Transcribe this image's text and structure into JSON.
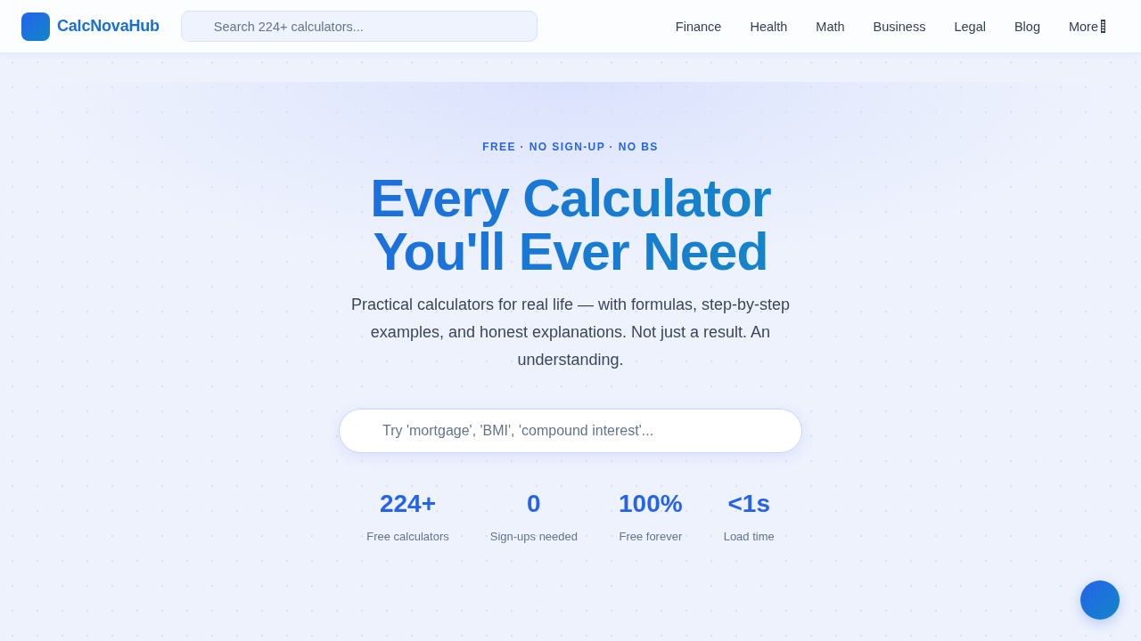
{
  "header": {
    "brand": "CalcNovaHub",
    "search": {
      "placeholder": "Search 224+ calculators..."
    },
    "nav": [
      {
        "label": "Finance",
        "kind": "link"
      },
      {
        "label": "Health",
        "kind": "link"
      },
      {
        "label": "Math",
        "kind": "link"
      },
      {
        "label": "Business",
        "kind": "link"
      },
      {
        "label": "Legal",
        "kind": "link"
      },
      {
        "label": "Blog",
        "kind": "link"
      },
      {
        "label": "More",
        "kind": "dropdown"
      }
    ]
  },
  "hero": {
    "eyebrow": "FREE · NO SIGN-UP · NO BS",
    "title": "Every Calculator You'll Ever Need",
    "subtitle": "Practical calculators for real life — with formulas, step-by-step examples, and honest explanations. Not just a result. An understanding.",
    "search": {
      "placeholder": "Try 'mortgage', 'BMI', 'compound interest'..."
    },
    "stats": [
      {
        "value": "224+",
        "label": "Free calculators"
      },
      {
        "value": "0",
        "label": "Sign-ups needed"
      },
      {
        "value": "100%",
        "label": "Free forever"
      },
      {
        "value": "<1s",
        "label": "Load time"
      }
    ]
  }
}
